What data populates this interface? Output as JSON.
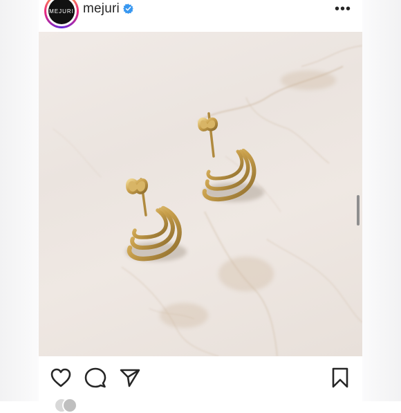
{
  "header": {
    "avatar_text": "MEJURI",
    "username": "mejuri",
    "verified_icon": "verified-badge-icon",
    "more_icon": "more-options-icon",
    "more_glyph": "•••"
  },
  "post": {
    "image_icon": "earrings-photo"
  },
  "actions": {
    "like_icon": "heart-icon",
    "comment_icon": "comment-icon",
    "share_icon": "send-icon",
    "save_icon": "bookmark-icon"
  },
  "colors": {
    "text": "#262626",
    "verified_blue": "#3897f0",
    "gold": "#c9a550",
    "marble": "#ede6e1"
  }
}
